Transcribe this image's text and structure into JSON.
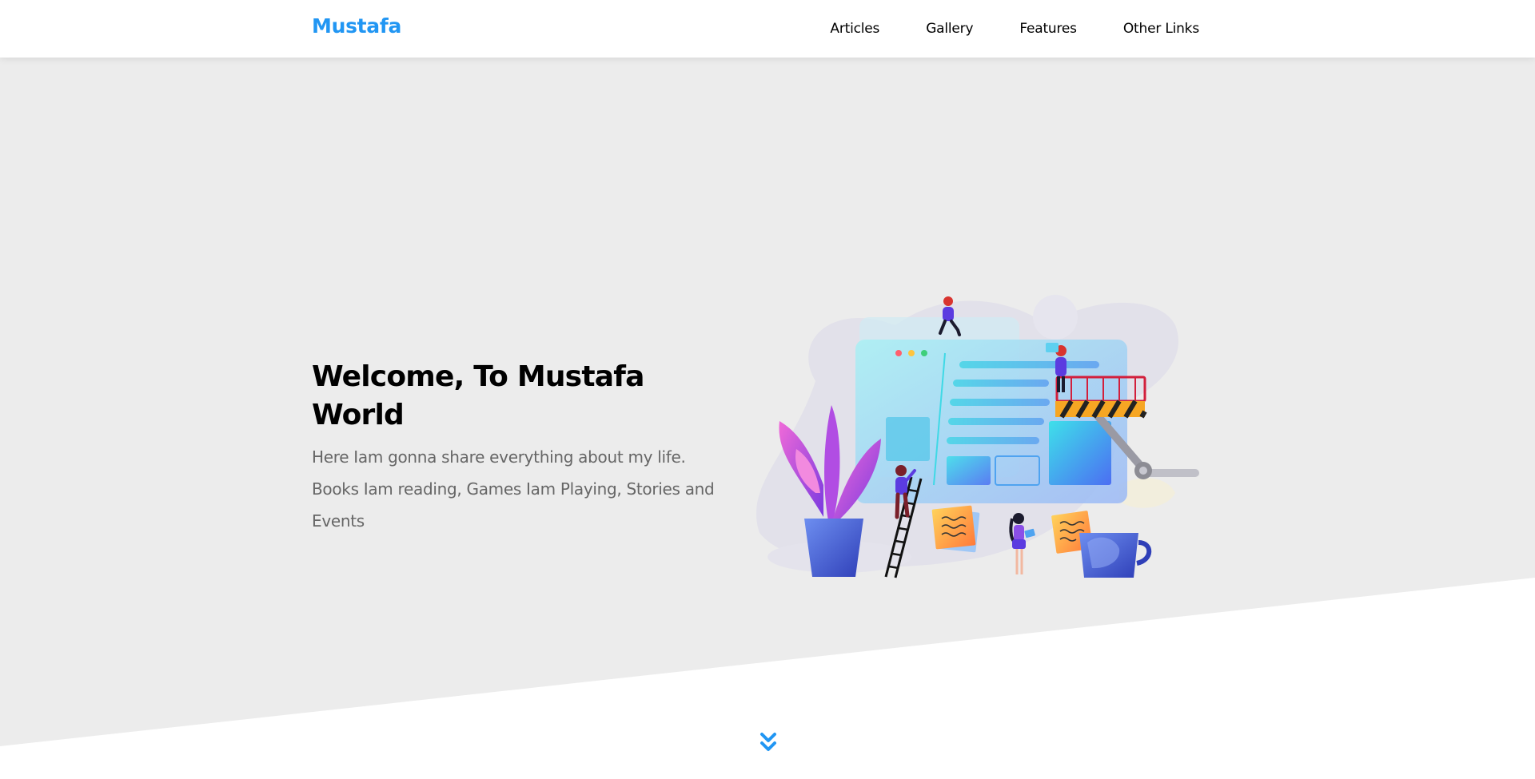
{
  "header": {
    "logo": "Mustafa",
    "nav": [
      {
        "label": "Articles"
      },
      {
        "label": "Gallery"
      },
      {
        "label": "Features"
      },
      {
        "label": "Other Links"
      }
    ]
  },
  "hero": {
    "title": "Welcome, To Mustafa World",
    "description": "Here Iam gonna share everything about my life. Books Iam reading, Games Iam Playing, Stories and Events",
    "illustration_icon": "landing-illustration"
  },
  "scroll_down_icon": "double-chevron-down-icon",
  "colors": {
    "accent": "#2196f3",
    "hero_bg": "#ececec",
    "text_dark": "#000000",
    "text_muted": "#666666"
  }
}
